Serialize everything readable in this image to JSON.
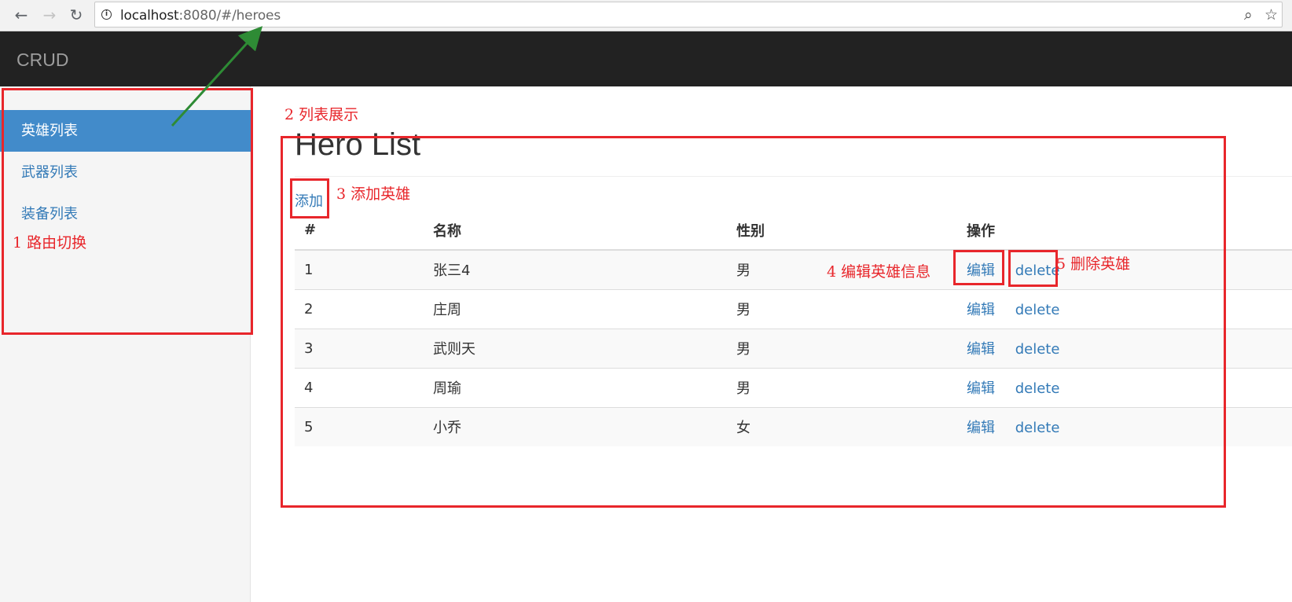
{
  "browser": {
    "url_host": "localhost",
    "url_rest": ":8080/#/heroes",
    "back_icon": "←",
    "forward_icon": "→",
    "reload_icon": "↻",
    "zoom_icon": "⌕",
    "star_icon": "☆",
    "info_icon": "i"
  },
  "navbar": {
    "brand": "CRUD"
  },
  "sidebar": {
    "items": [
      {
        "label": "英雄列表",
        "active": true
      },
      {
        "label": "武器列表",
        "active": false
      },
      {
        "label": "装备列表",
        "active": false
      }
    ]
  },
  "main": {
    "title": "Hero List",
    "add_label": "添加",
    "table": {
      "headers": [
        "#",
        "名称",
        "性别",
        "操作"
      ],
      "rows": [
        {
          "id": "1",
          "name": "张三4",
          "gender": "男",
          "edit": "编辑",
          "delete": "delete"
        },
        {
          "id": "2",
          "name": "庄周",
          "gender": "男",
          "edit": "编辑",
          "delete": "delete"
        },
        {
          "id": "3",
          "name": "武则天",
          "gender": "男",
          "edit": "编辑",
          "delete": "delete"
        },
        {
          "id": "4",
          "name": "周瑜",
          "gender": "男",
          "edit": "编辑",
          "delete": "delete"
        },
        {
          "id": "5",
          "name": "小乔",
          "gender": "女",
          "edit": "编辑",
          "delete": "delete"
        }
      ]
    }
  },
  "annotations": {
    "route_switch": "1 路由切换",
    "list_display": "2 列表展示",
    "add_hero": "3 添加英雄",
    "edit_hero": "4 编辑英雄信息",
    "delete_hero": "5 删除英雄",
    "color": "#e8262b",
    "arrow_color": "#2e8b35"
  },
  "colors": {
    "navbar_bg": "#222222",
    "brand": "#9d9d9d",
    "active_item_bg": "#428bca",
    "link": "#337ab7",
    "sidebar_bg": "#f5f5f5"
  }
}
